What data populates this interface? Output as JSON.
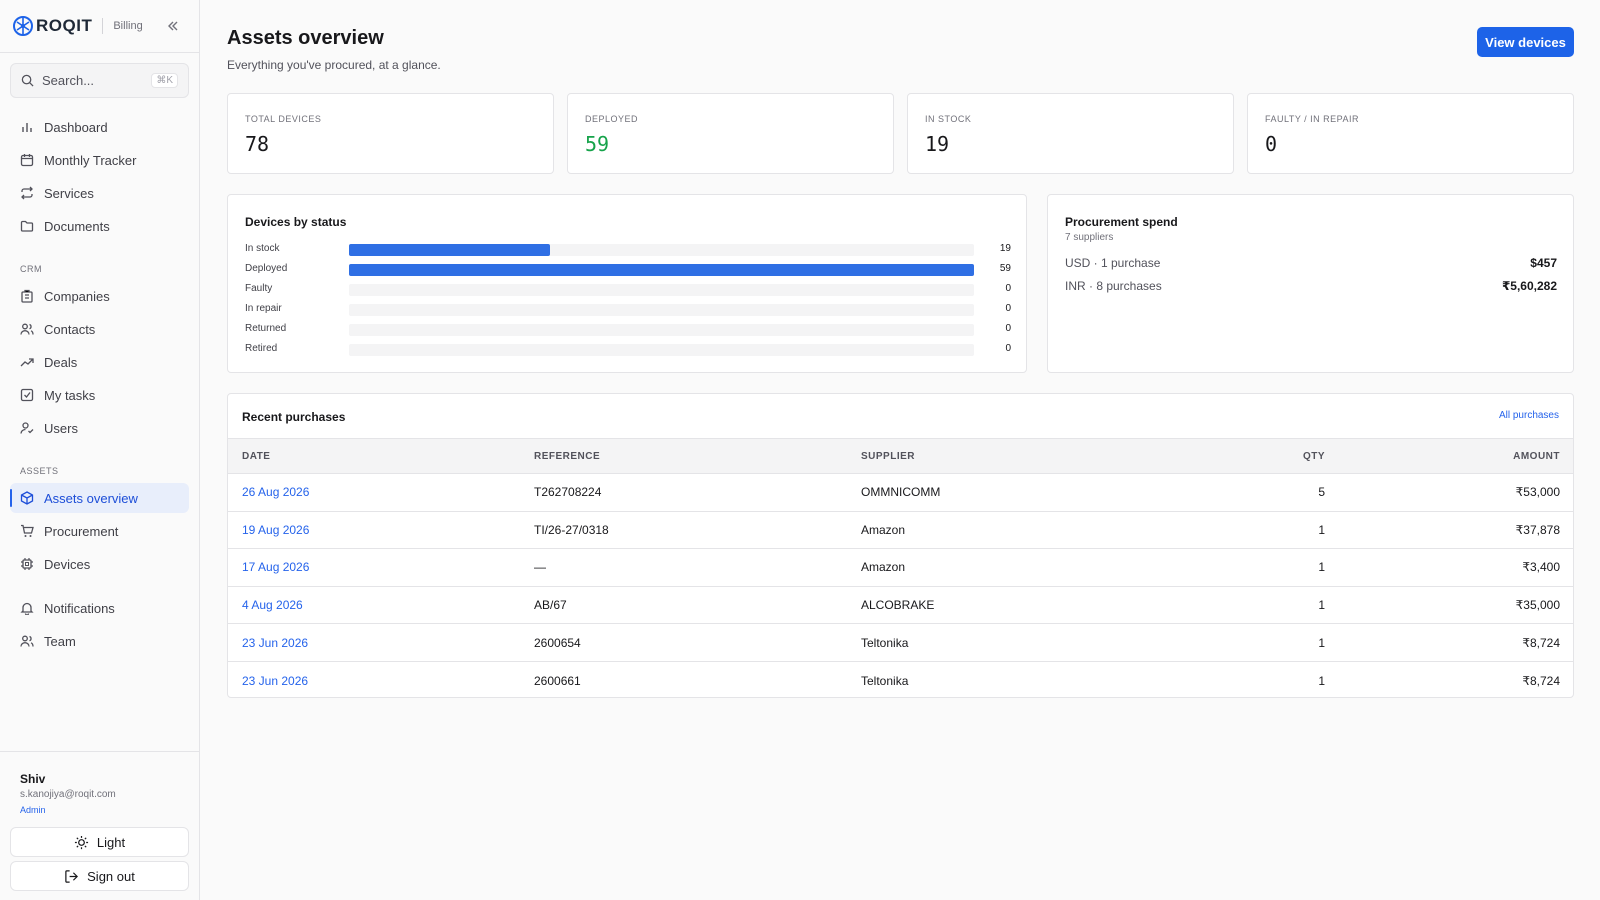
{
  "brand": {
    "name": "ROQIT",
    "section": "Billing",
    "accent": "#1d63e8"
  },
  "search": {
    "placeholder": "Search...",
    "shortcut": "⌘K"
  },
  "nav": {
    "main": [
      {
        "label": "Dashboard",
        "icon": "bar-chart-icon"
      },
      {
        "label": "Monthly Tracker",
        "icon": "calendar-icon"
      },
      {
        "label": "Services",
        "icon": "repeat-icon"
      },
      {
        "label": "Documents",
        "icon": "folder-icon"
      }
    ],
    "crm_heading": "CRM",
    "crm": [
      {
        "label": "Companies",
        "icon": "building-icon"
      },
      {
        "label": "Contacts",
        "icon": "users-icon"
      },
      {
        "label": "Deals",
        "icon": "trending-up-icon"
      },
      {
        "label": "My tasks",
        "icon": "check-square-icon"
      },
      {
        "label": "Users",
        "icon": "user-check-icon"
      }
    ],
    "assets_heading": "ASSETS",
    "assets": [
      {
        "label": "Assets overview",
        "icon": "box-icon",
        "active": true
      },
      {
        "label": "Procurement",
        "icon": "cart-icon"
      },
      {
        "label": "Devices",
        "icon": "cpu-icon"
      }
    ],
    "extra": [
      {
        "label": "Notifications",
        "icon": "bell-icon"
      },
      {
        "label": "Team",
        "icon": "team-icon"
      }
    ]
  },
  "user": {
    "name": "Shiv",
    "email": "s.kanojiya@roqit.com",
    "role": "Admin"
  },
  "theme_button": "Light",
  "signout_button": "Sign out",
  "page": {
    "title": "Assets overview",
    "subtitle": "Everything you've procured, at a glance.",
    "primary_action": "View devices"
  },
  "stats": [
    {
      "label": "TOTAL DEVICES",
      "value": "78"
    },
    {
      "label": "DEPLOYED",
      "value": "59",
      "color": "#16a34a"
    },
    {
      "label": "IN STOCK",
      "value": "19"
    },
    {
      "label": "FAULTY / IN REPAIR",
      "value": "0"
    }
  ],
  "status_panel": {
    "title": "Devices by status",
    "max": 59,
    "rows": [
      {
        "label": "In stock",
        "value": 19
      },
      {
        "label": "Deployed",
        "value": 59
      },
      {
        "label": "Faulty",
        "value": 0
      },
      {
        "label": "In repair",
        "value": 0
      },
      {
        "label": "Returned",
        "value": 0
      },
      {
        "label": "Retired",
        "value": 0
      }
    ]
  },
  "spend_panel": {
    "title": "Procurement spend",
    "subtitle": "7 suppliers",
    "rows": [
      {
        "label": "USD · 1 purchase",
        "amount": "$457"
      },
      {
        "label": "INR · 8 purchases",
        "amount": "₹5,60,282"
      }
    ]
  },
  "purchases": {
    "title": "Recent purchases",
    "link": "All purchases",
    "columns": [
      "DATE",
      "REFERENCE",
      "SUPPLIER",
      "QTY",
      "AMOUNT"
    ],
    "rows": [
      {
        "date": "26 Aug 2026",
        "reference": "T262708224",
        "supplier": "OMMNICOMM",
        "qty": "5",
        "amount": "₹53,000"
      },
      {
        "date": "19 Aug 2026",
        "reference": "TI/26-27/0318",
        "supplier": "Amazon",
        "qty": "1",
        "amount": "₹37,878"
      },
      {
        "date": "17 Aug 2026",
        "reference": "—",
        "supplier": "Amazon",
        "qty": "1",
        "amount": "₹3,400"
      },
      {
        "date": "4 Aug 2026",
        "reference": "AB/67",
        "supplier": "ALCOBRAKE",
        "qty": "1",
        "amount": "₹35,000"
      },
      {
        "date": "23 Jun 2026",
        "reference": "2600654",
        "supplier": "Teltonika",
        "qty": "1",
        "amount": "₹8,724"
      },
      {
        "date": "23 Jun 2026",
        "reference": "2600661",
        "supplier": "Teltonika",
        "qty": "1",
        "amount": "₹8,724"
      }
    ]
  }
}
